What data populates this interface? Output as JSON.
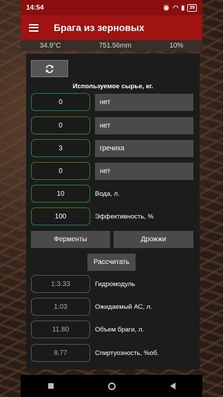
{
  "status_bar": {
    "time": "14:54",
    "battery": "39"
  },
  "app_bar": {
    "title": "Брага из зерновых"
  },
  "sensors": {
    "temperature": "34.9°C",
    "pressure": "751.56mm",
    "humidity": "10%"
  },
  "raw_material": {
    "title": "Используемое сырье, кг.",
    "rows": [
      {
        "amount": "0",
        "type": "нет"
      },
      {
        "amount": "0",
        "type": "нет"
      },
      {
        "amount": "3",
        "type": "гречиха"
      },
      {
        "amount": "0",
        "type": "нет"
      }
    ]
  },
  "water": {
    "value": "10",
    "label": "Вода, л."
  },
  "efficiency": {
    "value": "100",
    "label": "Эффективность, %"
  },
  "buttons": {
    "enzymes": "Ферменты",
    "yeast": "Дрожжи",
    "calculate": "Рассчитать"
  },
  "results": [
    {
      "value": "1:3.33",
      "label": "Гидромодуль"
    },
    {
      "value": "1.03",
      "label": "Ожидаемый АС, л."
    },
    {
      "value": "11.80",
      "label": "Объем браги, л."
    },
    {
      "value": "8.77",
      "label": "Спиртуозность, %об."
    }
  ]
}
